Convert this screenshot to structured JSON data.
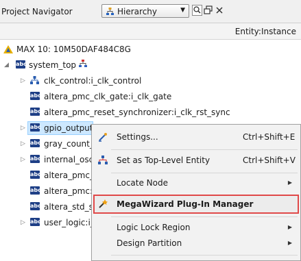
{
  "header": {
    "title": "Project Navigator",
    "view_select": "Hierarchy",
    "column_header": "Entity:Instance"
  },
  "tree": {
    "device": "MAX 10: 10M50DAF484C8G",
    "top": "system_top",
    "items": [
      {
        "label": "clk_control:i_clk_control"
      },
      {
        "label": "altera_pmc_clk_gate:i_clk_gate"
      },
      {
        "label": "altera_pmc_reset_synchronizer:i_clk_rst_sync"
      },
      {
        "label": "gpio_output:"
      },
      {
        "label": "gray_count_"
      },
      {
        "label": "internal_osc:"
      },
      {
        "label": "altera_pmc_r"
      },
      {
        "label": "altera_pmc:i"
      },
      {
        "label": "altera_std_sy"
      },
      {
        "label": "user_logic:i_"
      }
    ]
  },
  "menu": {
    "items": [
      {
        "label": "Settings...",
        "shortcut": "Ctrl+Shift+E"
      },
      {
        "label": "Set as Top-Level Entity",
        "shortcut": "Ctrl+Shift+V"
      },
      {
        "label": "Locate Node"
      },
      {
        "label": "MegaWizard Plug-In Manager"
      },
      {
        "label": "Logic Lock Region"
      },
      {
        "label": "Design Partition"
      }
    ]
  },
  "colors": {
    "highlight_border": "#e04848",
    "selection": "#cde8ff",
    "icon_blue": "#1e3f86"
  }
}
